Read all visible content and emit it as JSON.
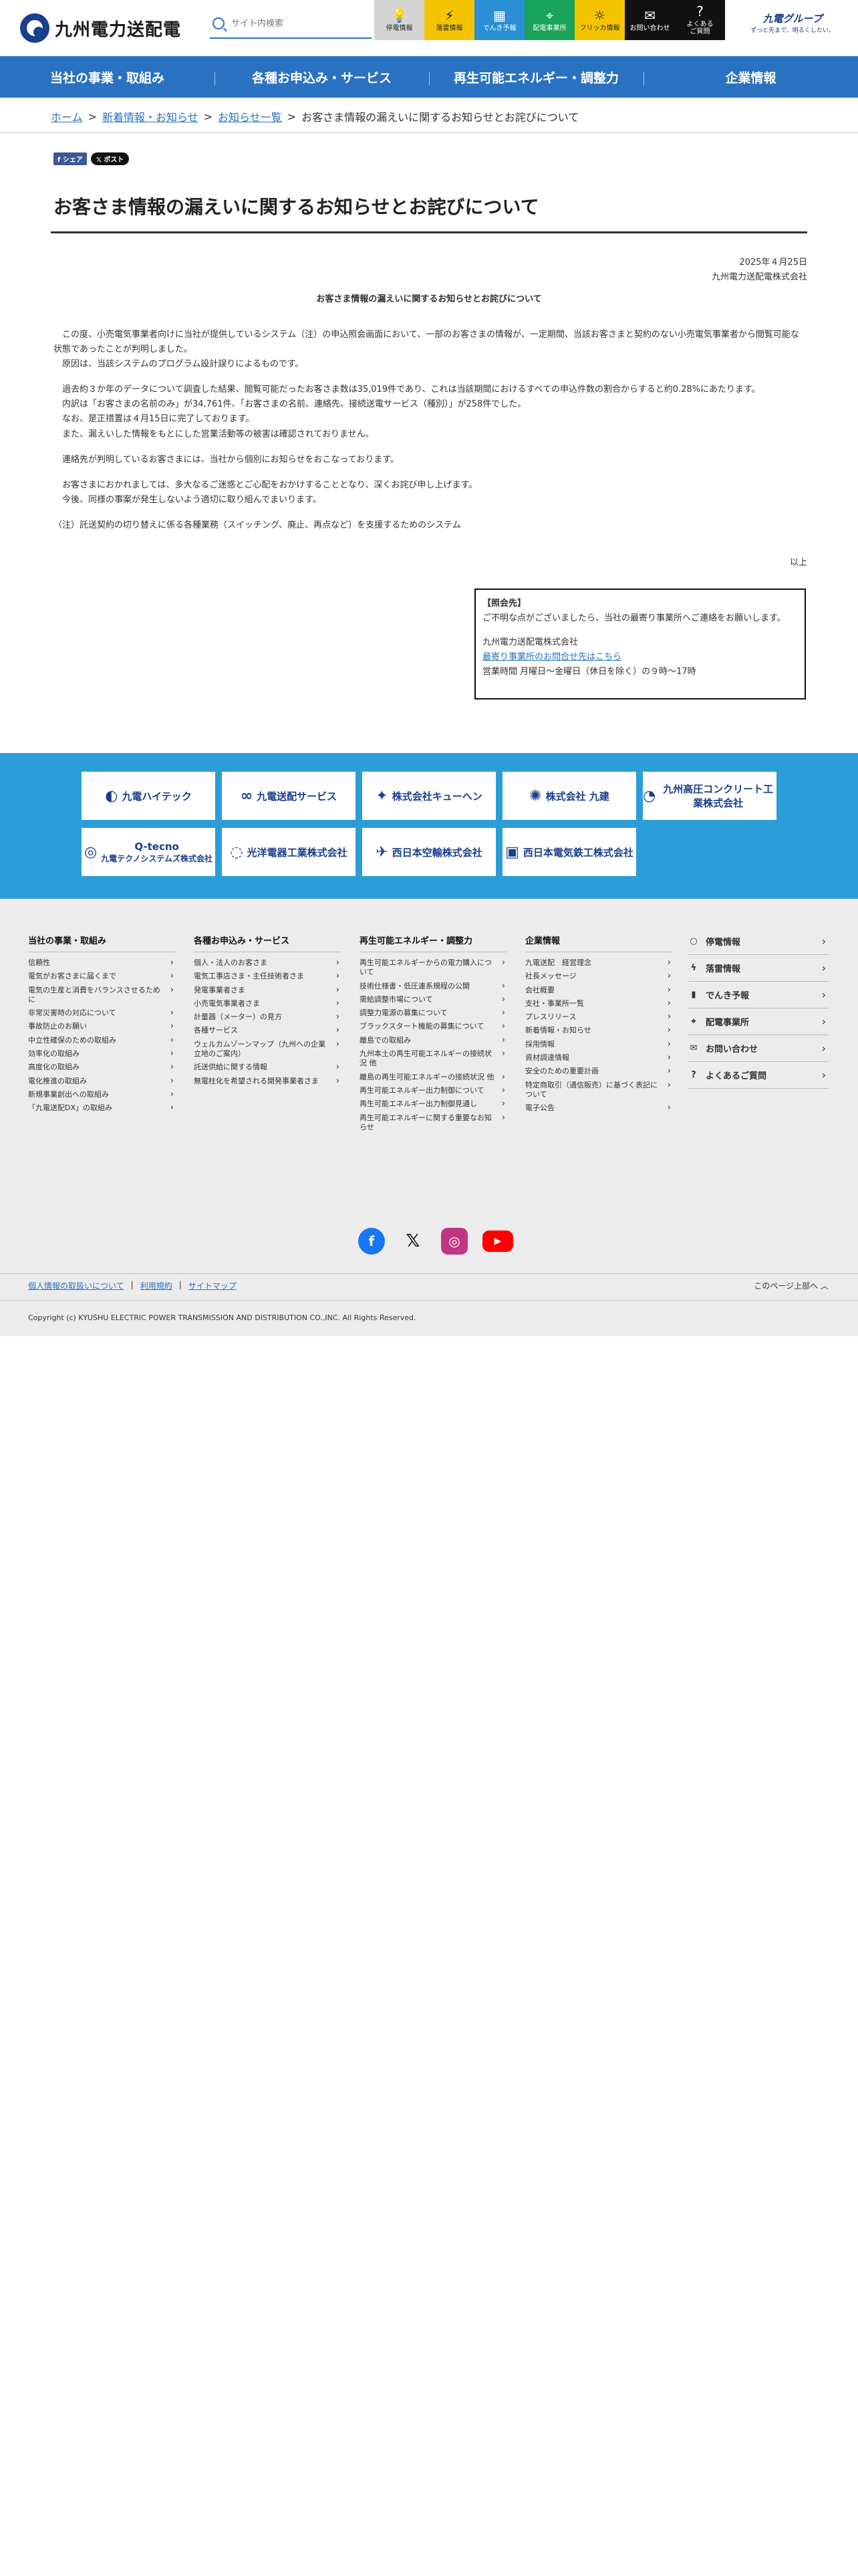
{
  "header": {
    "logo_text": "九州電力送配電",
    "search_placeholder": "サイト内検索",
    "quick_links": [
      {
        "label": "停電情報",
        "icon": "lightbulb-icon",
        "glyph": "💡"
      },
      {
        "label": "落雷情報",
        "icon": "lightning-icon",
        "glyph": "⚡"
      },
      {
        "label": "でんき予報",
        "icon": "meter-icon",
        "glyph": "▦"
      },
      {
        "label": "配電事業所",
        "icon": "map-pin-icon",
        "glyph": "⌖"
      },
      {
        "label": "フリッカ情報",
        "icon": "flicker-icon",
        "glyph": "☼"
      },
      {
        "label": "お問い合わせ",
        "icon": "mail-icon",
        "glyph": "✉"
      },
      {
        "label": "よくある\nご質問",
        "icon": "question-icon",
        "glyph": "?"
      }
    ],
    "group_logo": {
      "name": "九電グループ",
      "tagline": "ずっと先まで、明るくしたい。"
    }
  },
  "nav": {
    "items": [
      "当社の事業・取組み",
      "各種お申込み・サービス",
      "再生可能エネルギー・調整力",
      "企業情報"
    ]
  },
  "breadcrumb": {
    "home": "ホーム",
    "news": "新着情報・お知らせ",
    "list": "お知らせ一覧",
    "current": "お客さま情報の漏えいに関するお知らせとお詫びについて",
    "sep": ">"
  },
  "share": {
    "facebook": "シェア",
    "x": "ポスト"
  },
  "article": {
    "title": "お客さま情報の漏えいに関するお知らせとお詫びについて",
    "date": "2025年４月25日",
    "company": "九州電力送配電株式会社",
    "heading": "お客さま情報の漏えいに関するお知らせとお詫びについて",
    "paragraphs": [
      "　この度、小売電気事業者向けに当社が提供しているシステム（注）の申込照会画面において、一部のお客さまの情報が、一定期間、当該お客さまと契約のない小売電気事業者から閲覧可能な状態であったことが判明しました。\n　原因は、当該システムのプログラム設計誤りによるものです。",
      "　過去約３か年のデータについて調査した結果、閲覧可能だったお客さま数は35,019件であり、これは当該期間におけるすべての申込件数の割合からすると約0.28%にあたります。\n　内訳は「お客さまの名前のみ」が34,761件、「お客さまの名前、連絡先、接続送電サービス（種別）」が258件でした。\n　なお、是正措置は４月15日に完了しております。\n　また、漏えいした情報をもとにした営業活動等の被害は確認されておりません。",
      "　連絡先が判明しているお客さまには、当社から個別にお知らせをおこなっております。",
      "　お客さまにおかれましては、多大なるご迷惑とご心配をおかけすることとなり、深くお詫び申し上げます。\n　今後、同様の事案が発生しないよう適切に取り組んでまいります。",
      "（注）託送契約の切り替えに係る各種業務（スイッチング、廃止、再点など）を支援するためのシステム"
    ],
    "closing": "以上"
  },
  "contact": {
    "heading": "【照会先】",
    "intro": "ご不明な点がございましたら、当社の最寄り事業所へご連絡をお願いします。",
    "company": "九州電力送配電株式会社",
    "link": "最寄り事業所のお問合せ先はこちら",
    "hours": "営業時間 月曜日～金曜日（休日を除く）の９時～17時"
  },
  "group_companies": [
    {
      "name": "九電ハイテック",
      "mark": "◐"
    },
    {
      "name": "九電送配サービス",
      "mark": "∞"
    },
    {
      "name": "株式会社キューヘン",
      "mark": "✦"
    },
    {
      "name": "株式会社 九建",
      "mark": "✺"
    },
    {
      "name": "九州高圧コンクリート工業株式会社",
      "mark": "◔"
    },
    {
      "name": "Q-tecno",
      "sub": "九電テクノシステムズ株式会社",
      "mark": "◎"
    },
    {
      "name": "光洋電器工業株式会社",
      "mark": "◌"
    },
    {
      "name": "西日本空輸株式会社",
      "mark": "✈"
    },
    {
      "name": "西日本電気鉄工株式会社",
      "mark": "▣"
    }
  ],
  "footer": {
    "columns": [
      {
        "title": "当社の事業・取組み",
        "items": [
          "信頼性",
          "電気がお客さまに届くまで",
          "電気の生産と消費をバランスさせるために",
          "非常災害時の対応について",
          "事故防止のお願い",
          "中立性確保のための取組み",
          "効率化の取組み",
          "高度化の取組み",
          "電化推進の取組み",
          "新規事業創出への取組み",
          "「九電送配DX」の取組み"
        ]
      },
      {
        "title": "各種お申込み・サービス",
        "items": [
          "個人・法人のお客さま",
          "電気工事店さま・主任技術者さま",
          "発電事業者さま",
          "小売電気事業者さま",
          "計量器（メーター）の見方",
          "各種サービス",
          "ウェルカムゾーンマップ（九州への企業立地のご案内）",
          "託送供給に関する情報",
          "無電柱化を希望される開発事業者さま"
        ]
      },
      {
        "title": "再生可能エネルギー・調整力",
        "items": [
          "再生可能エネルギーからの電力購入について",
          "技術仕様書・低圧連系規程の公開",
          "需給調整市場について",
          "調整力電源の募集について",
          "ブラックスタート機能の募集について",
          "離島での取組み",
          "九州本土の再生可能エネルギーの接続状況 他",
          "離島の再生可能エネルギーの接続状況 他",
          "再生可能エネルギー出力制御について",
          "再生可能エネルギー出力制御見通し",
          "再生可能エネルギーに関する重要なお知らせ"
        ]
      },
      {
        "title": "企業情報",
        "items": [
          "九電送配　経営理念",
          "社長メッセージ",
          "会社概要",
          "支社・事業所一覧",
          "プレスリリース",
          "新着情報・お知らせ",
          "採用情報",
          "資材調達情報",
          "安全のための重要計画",
          "特定商取引（通信販売）に基づく表記について",
          "電子公告"
        ]
      }
    ],
    "quick": [
      {
        "label": "停電情報",
        "icon": "lightbulb-icon",
        "glyph": "○"
      },
      {
        "label": "落雷情報",
        "icon": "lightning-icon",
        "glyph": "ϟ"
      },
      {
        "label": "でんき予報",
        "icon": "meter-icon",
        "glyph": "▮"
      },
      {
        "label": "配電事業所",
        "icon": "map-pin-icon",
        "glyph": "⌖"
      },
      {
        "label": "お問い合わせ",
        "icon": "mail-icon",
        "glyph": "✉"
      },
      {
        "label": "よくあるご質問",
        "icon": "question-icon",
        "glyph": "?"
      }
    ],
    "sns": {
      "facebook": "f",
      "x": "𝕏",
      "instagram": "◎",
      "youtube": "▶"
    },
    "links": [
      "個人情報の取扱いについて",
      "利用規約",
      "サイトマップ"
    ],
    "page_top": "このページ上部へ",
    "copyright": "Copyright (c) KYUSHU ELECTRIC POWER TRANSMISSION AND DISTRIBUTION CO.,INC. All Rights Reserved."
  }
}
